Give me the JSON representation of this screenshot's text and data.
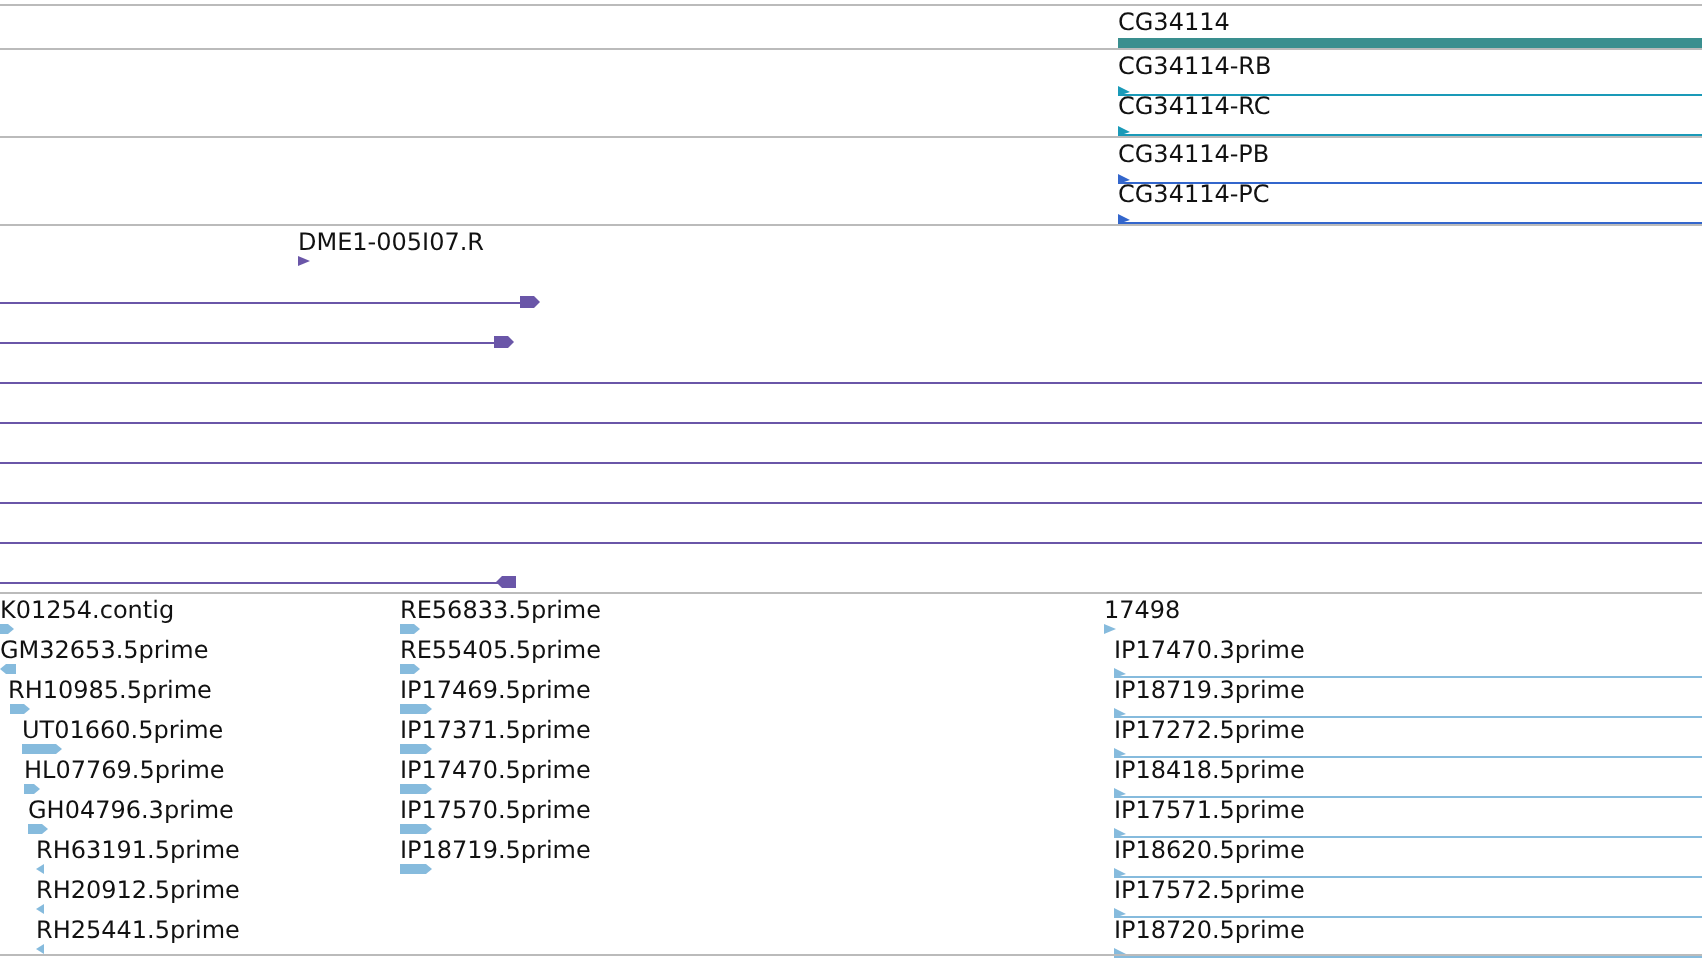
{
  "tracks": [
    {
      "kind": "gene",
      "features": [
        {
          "label": "CG34114"
        }
      ]
    },
    {
      "kind": "transcript",
      "features": [
        {
          "label": "CG34114-RB",
          "points_right": true,
          "points_left": false
        },
        {
          "label": "CG34114-RC",
          "points_right": true,
          "points_left": false
        }
      ]
    },
    {
      "kind": "protein",
      "features": [
        {
          "label": "CG34114-PB",
          "points_right": true,
          "points_left": false
        },
        {
          "label": "CG34114-PC",
          "points_right": true,
          "points_left": false
        }
      ]
    },
    {
      "kind": "clone",
      "features": [
        {
          "label": "DME1-005I07.R",
          "points_right": true,
          "points_left": false
        },
        {
          "points_right": true,
          "points_left": false
        },
        {
          "points_right": true,
          "points_left": false
        },
        {
          "points_right": false,
          "points_left": false
        },
        {
          "points_right": false,
          "points_left": false
        },
        {
          "points_right": false,
          "points_left": false
        },
        {
          "points_right": false,
          "points_left": false
        },
        {
          "points_right": false,
          "points_left": false
        },
        {
          "points_right": false,
          "points_left": true
        }
      ]
    },
    {
      "kind": "est",
      "features": [
        {
          "label": "K01254.contig",
          "points_right": true,
          "points_left": false
        },
        {
          "label": "GM32653.5prime",
          "points_right": false,
          "points_left": true
        },
        {
          "label": "RH10985.5prime",
          "points_right": true,
          "points_left": false
        },
        {
          "label": "UT01660.5prime",
          "points_right": true,
          "points_left": false
        },
        {
          "label": "HL07769.5prime",
          "points_right": true,
          "points_left": false
        },
        {
          "label": "GH04796.3prime",
          "points_right": true,
          "points_left": false
        },
        {
          "label": "RH63191.5prime",
          "points_right": false,
          "points_left": true
        },
        {
          "label": "RH20912.5prime",
          "points_right": false,
          "points_left": true
        },
        {
          "label": "RH25441.5prime",
          "points_right": false,
          "points_left": true
        },
        {
          "label": "RE56833.5prime",
          "points_right": true,
          "points_left": false
        },
        {
          "label": "RE55405.5prime",
          "points_right": true,
          "points_left": false
        },
        {
          "label": "IP17469.5prime",
          "points_right": true,
          "points_left": false
        },
        {
          "label": "IP17371.5prime",
          "points_right": true,
          "points_left": false
        },
        {
          "label": "IP17470.5prime",
          "points_right": true,
          "points_left": false
        },
        {
          "label": "IP17570.5prime",
          "points_right": true,
          "points_left": false
        },
        {
          "label": "IP18719.5prime",
          "points_right": true,
          "points_left": false
        },
        {
          "label": "17498",
          "points_right": true,
          "points_left": false
        },
        {
          "label": "IP17470.3prime",
          "points_right": true,
          "points_left": false
        },
        {
          "label": "IP18719.3prime",
          "points_right": true,
          "points_left": false
        },
        {
          "label": "IP17272.5prime",
          "points_right": true,
          "points_left": false
        },
        {
          "label": "IP18418.5prime",
          "points_right": true,
          "points_left": false
        },
        {
          "label": "IP17571.5prime",
          "points_right": true,
          "points_left": false
        },
        {
          "label": "IP18620.5prime",
          "points_right": true,
          "points_left": false
        },
        {
          "label": "IP17572.5prime",
          "points_right": true,
          "points_left": false
        },
        {
          "label": "IP18720.5prime",
          "points_right": true,
          "points_left": false
        }
      ]
    }
  ]
}
